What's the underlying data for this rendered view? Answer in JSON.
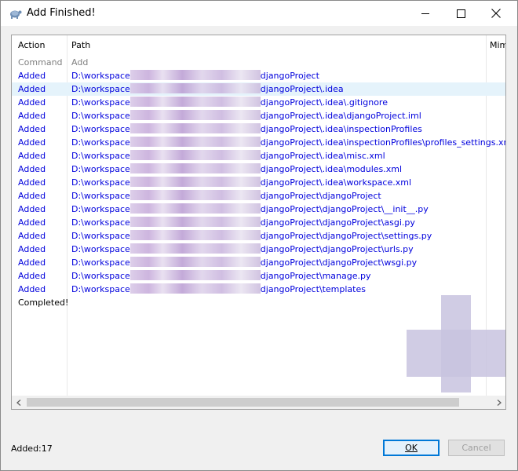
{
  "window": {
    "title": "Add Finished!"
  },
  "table": {
    "columns": [
      "Action",
      "Path",
      "Mime"
    ],
    "rows": [
      {
        "action": "Command",
        "pre": "Add",
        "post": "",
        "kind": "command"
      },
      {
        "action": "Added",
        "pre": "D:\\workspace",
        "post": "djangoProject",
        "kind": "added"
      },
      {
        "action": "Added",
        "pre": "D:\\workspace",
        "post": "djangoProject\\.idea",
        "kind": "added",
        "selected": true
      },
      {
        "action": "Added",
        "pre": "D:\\workspace",
        "post": "djangoProject\\.idea\\.gitignore",
        "kind": "added"
      },
      {
        "action": "Added",
        "pre": "D:\\workspace",
        "post": "djangoProject\\.idea\\djangoProject.iml",
        "kind": "added"
      },
      {
        "action": "Added",
        "pre": "D:\\workspace",
        "post": "djangoProject\\.idea\\inspectionProfiles",
        "kind": "added"
      },
      {
        "action": "Added",
        "pre": "D:\\workspace",
        "post": "djangoProject\\.idea\\inspectionProfiles\\profiles_settings.xml",
        "kind": "added"
      },
      {
        "action": "Added",
        "pre": "D:\\workspace",
        "post": "djangoProject\\.idea\\misc.xml",
        "kind": "added"
      },
      {
        "action": "Added",
        "pre": "D:\\workspace",
        "post": "djangoProject\\.idea\\modules.xml",
        "kind": "added"
      },
      {
        "action": "Added",
        "pre": "D:\\workspace",
        "post": "djangoProject\\.idea\\workspace.xml",
        "kind": "added"
      },
      {
        "action": "Added",
        "pre": "D:\\workspace",
        "post": "djangoProject\\djangoProject",
        "kind": "added"
      },
      {
        "action": "Added",
        "pre": "D:\\workspace",
        "post": "djangoProject\\djangoProject\\__init__.py",
        "kind": "added"
      },
      {
        "action": "Added",
        "pre": "D:\\workspace",
        "post": "djangoProject\\djangoProject\\asgi.py",
        "kind": "added"
      },
      {
        "action": "Added",
        "pre": "D:\\workspace",
        "post": "djangoProject\\djangoProject\\settings.py",
        "kind": "added"
      },
      {
        "action": "Added",
        "pre": "D:\\workspace",
        "post": "djangoProject\\djangoProject\\urls.py",
        "kind": "added"
      },
      {
        "action": "Added",
        "pre": "D:\\workspace",
        "post": "djangoProject\\djangoProject\\wsgi.py",
        "kind": "added"
      },
      {
        "action": "Added",
        "pre": "D:\\workspace",
        "post": "djangoProject\\manage.py",
        "kind": "added"
      },
      {
        "action": "Added",
        "pre": "D:\\workspace",
        "post": "djangoProject\\templates",
        "kind": "added"
      },
      {
        "action": "Completed!",
        "pre": "",
        "post": "",
        "kind": "completed"
      }
    ]
  },
  "status": {
    "text": "Added:17"
  },
  "buttons": {
    "ok": "OK",
    "cancel": "Cancel"
  },
  "colors": {
    "added": "#0000dd",
    "command": "#808080",
    "selected_row": "#e5f3fb",
    "accent": "#0078d7"
  }
}
